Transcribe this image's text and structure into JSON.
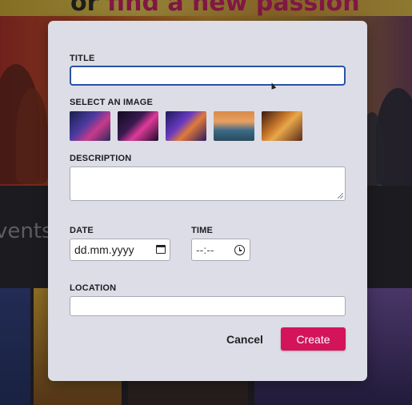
{
  "background": {
    "hero_title_prefix": "or",
    "hero_title_accent": "find a new passion",
    "events_label": "vents"
  },
  "modal": {
    "title_label": "TITLE",
    "title_value": "",
    "image_label": "SELECT AN IMAGE",
    "images": [
      {
        "icon": "city-neon-image"
      },
      {
        "icon": "desk-workspace-image"
      },
      {
        "icon": "party-crowd-image"
      },
      {
        "icon": "river-city-sunset-image"
      },
      {
        "icon": "friends-cafe-image"
      }
    ],
    "description_label": "DESCRIPTION",
    "description_value": "",
    "date_label": "DATE",
    "date_placeholder": "dd.mm.yyyy",
    "time_label": "TIME",
    "time_placeholder": "--:--",
    "location_label": "LOCATION",
    "location_value": "",
    "cancel_label": "Cancel",
    "create_label": "Create"
  },
  "colors": {
    "accent": "#d4145a",
    "focus_border": "#2a52a8",
    "modal_bg": "#dcdde6"
  }
}
